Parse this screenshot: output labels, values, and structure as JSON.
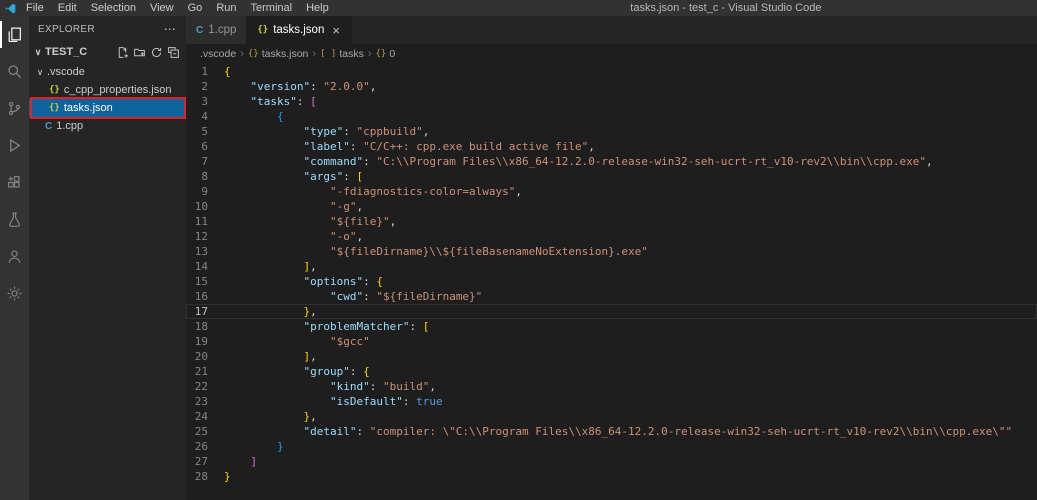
{
  "colors": {
    "editor_bg": "#1e1e1e",
    "sidebar_bg": "#252526",
    "activitybar_bg": "#333333",
    "titlebar_bg": "#323233",
    "selection_bg": "#0e639c",
    "annotation_red": "#ea1c24",
    "json_key": "#9cdcfe",
    "json_string": "#ce9178",
    "json_keyword": "#569cd6",
    "bracket_level1": "#ffd700",
    "bracket_level2": "#da70d6",
    "bracket_level3": "#179fff"
  },
  "window": {
    "title": "tasks.json - test_c - Visual Studio Code",
    "menu": [
      "File",
      "Edit",
      "Selection",
      "View",
      "Go",
      "Run",
      "Terminal",
      "Help"
    ]
  },
  "activity_bar": {
    "items": [
      "explorer",
      "search",
      "source-control",
      "run-and-debug",
      "extensions",
      "testing",
      "accounts",
      "settings"
    ]
  },
  "sidebar": {
    "header": "EXPLORER",
    "more_label": "⋯",
    "section": {
      "name": "TEST_C",
      "actions": [
        "new-file",
        "new-folder",
        "refresh-explorer",
        "collapse-folders"
      ]
    },
    "tree": [
      {
        "label": ".vscode",
        "kind": "folder",
        "expanded": true
      },
      {
        "label": "c_cpp_properties.json",
        "kind": "json"
      },
      {
        "label": "tasks.json",
        "kind": "json",
        "selected": true,
        "annotated": true
      },
      {
        "label": "1.cpp",
        "kind": "cpp"
      }
    ]
  },
  "icons": {
    "chevron_down": "∨",
    "json_glyph": "{}",
    "cpp_glyph": "C",
    "close": "×",
    "crumb_sep": "›",
    "bracket_glyph": "[ ]"
  },
  "editor": {
    "tabs": [
      {
        "label": "1.cpp",
        "icon": "cpp",
        "active": false
      },
      {
        "label": "tasks.json",
        "icon": "json",
        "active": true,
        "close": "×"
      }
    ],
    "breadcrumb": [
      {
        "icon": "",
        "label": ".vscode"
      },
      {
        "icon": "{}",
        "label": "tasks.json"
      },
      {
        "icon": "[ ]",
        "label": "tasks"
      },
      {
        "icon": "{}",
        "label": "0"
      }
    ],
    "active_line": 17,
    "lines": [
      [
        [
          "{",
          "b1"
        ]
      ],
      [
        [
          "    ",
          "p"
        ],
        [
          "\"version\"",
          "k"
        ],
        [
          ": ",
          "p"
        ],
        [
          "\"2.0.0\"",
          "s"
        ],
        [
          ",",
          "p"
        ]
      ],
      [
        [
          "    ",
          "p"
        ],
        [
          "\"tasks\"",
          "k"
        ],
        [
          ": ",
          "p"
        ],
        [
          "[",
          "b2"
        ]
      ],
      [
        [
          "        ",
          "p"
        ],
        [
          "{",
          "b3"
        ]
      ],
      [
        [
          "            ",
          "p"
        ],
        [
          "\"type\"",
          "k"
        ],
        [
          ": ",
          "p"
        ],
        [
          "\"cppbuild\"",
          "s"
        ],
        [
          ",",
          "p"
        ]
      ],
      [
        [
          "            ",
          "p"
        ],
        [
          "\"label\"",
          "k"
        ],
        [
          ": ",
          "p"
        ],
        [
          "\"C/C++: cpp.exe build active file\"",
          "s"
        ],
        [
          ",",
          "p"
        ]
      ],
      [
        [
          "            ",
          "p"
        ],
        [
          "\"command\"",
          "k"
        ],
        [
          ": ",
          "p"
        ],
        [
          "\"C:\\\\Program Files\\\\x86_64-12.2.0-release-win32-seh-ucrt-rt_v10-rev2\\\\bin\\\\cpp.exe\"",
          "s"
        ],
        [
          ",",
          "p"
        ]
      ],
      [
        [
          "            ",
          "p"
        ],
        [
          "\"args\"",
          "k"
        ],
        [
          ": ",
          "p"
        ],
        [
          "[",
          "b1"
        ]
      ],
      [
        [
          "                ",
          "p"
        ],
        [
          "\"-fdiagnostics-color=always\"",
          "s"
        ],
        [
          ",",
          "p"
        ]
      ],
      [
        [
          "                ",
          "p"
        ],
        [
          "\"-g\"",
          "s"
        ],
        [
          ",",
          "p"
        ]
      ],
      [
        [
          "                ",
          "p"
        ],
        [
          "\"${file}\"",
          "s"
        ],
        [
          ",",
          "p"
        ]
      ],
      [
        [
          "                ",
          "p"
        ],
        [
          "\"-o\"",
          "s"
        ],
        [
          ",",
          "p"
        ]
      ],
      [
        [
          "                ",
          "p"
        ],
        [
          "\"${fileDirname}\\\\${fileBasenameNoExtension}.exe\"",
          "s"
        ]
      ],
      [
        [
          "            ",
          "p"
        ],
        [
          "]",
          "b1"
        ],
        [
          ",",
          "p"
        ]
      ],
      [
        [
          "            ",
          "p"
        ],
        [
          "\"options\"",
          "k"
        ],
        [
          ": ",
          "p"
        ],
        [
          "{",
          "b1"
        ]
      ],
      [
        [
          "                ",
          "p"
        ],
        [
          "\"cwd\"",
          "k"
        ],
        [
          ": ",
          "p"
        ],
        [
          "\"${fileDirname}\"",
          "s"
        ]
      ],
      [
        [
          "            ",
          "p"
        ],
        [
          "}",
          "b1"
        ],
        [
          ",",
          "p"
        ]
      ],
      [
        [
          "            ",
          "p"
        ],
        [
          "\"problemMatcher\"",
          "k"
        ],
        [
          ": ",
          "p"
        ],
        [
          "[",
          "b1"
        ]
      ],
      [
        [
          "                ",
          "p"
        ],
        [
          "\"$gcc\"",
          "s"
        ]
      ],
      [
        [
          "            ",
          "p"
        ],
        [
          "]",
          "b1"
        ],
        [
          ",",
          "p"
        ]
      ],
      [
        [
          "            ",
          "p"
        ],
        [
          "\"group\"",
          "k"
        ],
        [
          ": ",
          "p"
        ],
        [
          "{",
          "b1"
        ]
      ],
      [
        [
          "                ",
          "p"
        ],
        [
          "\"kind\"",
          "k"
        ],
        [
          ": ",
          "p"
        ],
        [
          "\"build\"",
          "s"
        ],
        [
          ",",
          "p"
        ]
      ],
      [
        [
          "                ",
          "p"
        ],
        [
          "\"isDefault\"",
          "k"
        ],
        [
          ": ",
          "p"
        ],
        [
          "true",
          "kw"
        ]
      ],
      [
        [
          "            ",
          "p"
        ],
        [
          "}",
          "b1"
        ],
        [
          ",",
          "p"
        ]
      ],
      [
        [
          "            ",
          "p"
        ],
        [
          "\"detail\"",
          "k"
        ],
        [
          ": ",
          "p"
        ],
        [
          "\"compiler: \\\"C:\\\\Program Files\\\\x86_64-12.2.0-release-win32-seh-ucrt-rt_v10-rev2\\\\bin\\\\cpp.exe\\\"\"",
          "s"
        ]
      ],
      [
        [
          "        ",
          "p"
        ],
        [
          "}",
          "b3"
        ]
      ],
      [
        [
          "    ",
          "p"
        ],
        [
          "]",
          "b2"
        ]
      ],
      [
        [
          "}",
          "b1"
        ]
      ]
    ]
  }
}
